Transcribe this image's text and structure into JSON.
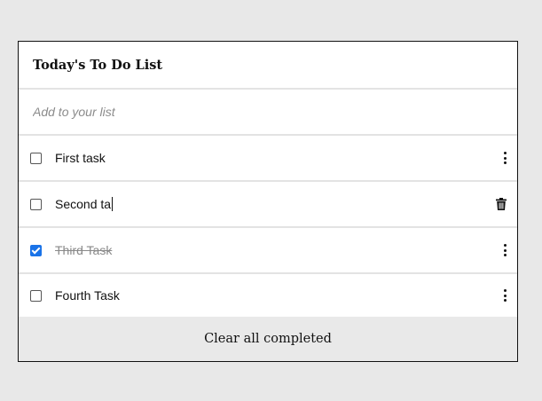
{
  "list": {
    "title": "Today's To Do List",
    "add_placeholder": "Add to your list",
    "tasks": [
      {
        "label": "First task",
        "completed": false,
        "action_icon": "kebab-menu-icon"
      },
      {
        "label": "Second ta",
        "completed": false,
        "editing": true,
        "action_icon": "trash-icon"
      },
      {
        "label": "Third Task",
        "completed": true,
        "action_icon": "kebab-menu-icon"
      },
      {
        "label": "Fourth Task",
        "completed": false,
        "action_icon": "kebab-menu-icon"
      }
    ],
    "clear_label": "Clear all completed"
  },
  "colors": {
    "background": "#e8e8e8",
    "card": "#ffffff",
    "checkbox_checked": "#1a73e8",
    "completed_text": "#8a8a8a",
    "footer": "#e9e9e9"
  }
}
